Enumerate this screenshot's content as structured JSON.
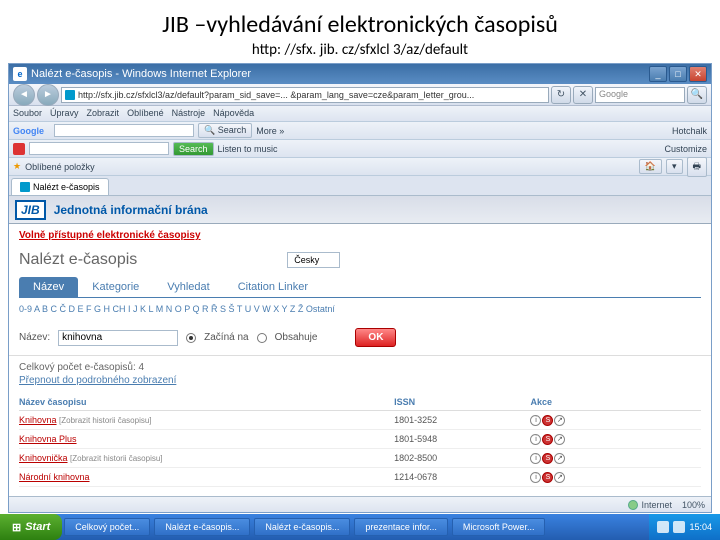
{
  "slide": {
    "title": "JIB –vyhledávání elektronických časopisů",
    "url": "http: //sfx. jib. cz/sfxlcl 3/az/default"
  },
  "window": {
    "title": "Nalézt e-časopis - Windows Internet Explorer",
    "url_display": "http://sfx.jib.cz/sfxlcl3/az/default?param_sid_save=... &param_lang_save=cze&param_letter_grou...",
    "search_placeholder": "Google"
  },
  "menubar": [
    "Soubor",
    "Úpravy",
    "Zobrazit",
    "Oblíbené",
    "Nástroje",
    "Nápověda"
  ],
  "google_toolbar": {
    "label": "Google",
    "search_btn": "Search",
    "more": "More »",
    "hotchalk": "Hotchalk"
  },
  "ask_toolbar": {
    "label": "",
    "search_btn": "Search",
    "listen": "Listen to music",
    "customize": "Customize"
  },
  "fav_toolbar": {
    "label": "Oblíbené položky"
  },
  "tab": "Nalézt e-časopis",
  "page": {
    "header_brand": "JIB",
    "header_text": "Jednotná informační brána",
    "redline": "Volně přístupné elektronické časopisy",
    "heading": "Nalézt e-časopis",
    "lang": "Česky",
    "tabs": [
      "Název",
      "Kategorie",
      "Vyhledat",
      "Citation Linker"
    ],
    "alpha": "0-9 A B C Č D E F G H CH I J K L M N O P Q R Ř S Š T U V W X Y Z Ž Ostatní",
    "name_label": "Název:",
    "name_value": "knihovna",
    "radio_begins": "Začíná na",
    "radio_contains": "Obsahuje",
    "ok": "OK",
    "total": "Celkový počet e-časopisů: 4",
    "switch": "Přepnout do podrobného zobrazení",
    "cols": {
      "name": "Název časopisu",
      "issn": "ISSN",
      "actions": "Akce"
    },
    "rows": [
      {
        "name": "Knihovna",
        "meta": "[Zobrazit historii časopisu]",
        "issn": "1801-3252"
      },
      {
        "name": "Knihovna Plus",
        "meta": "",
        "issn": "1801-5948"
      },
      {
        "name": "Knihovnička",
        "meta": "[Zobrazit historii časopisu]",
        "issn": "1802-8500"
      },
      {
        "name": "Národní knihovna",
        "meta": "",
        "issn": "1214-0678"
      }
    ]
  },
  "statusbar": {
    "zone": "Internet",
    "zoom": "100%"
  },
  "taskbar": {
    "start": "Start",
    "items": [
      "Celkový počet...",
      "Nalézt e-časopis...",
      "Nalézt e-časopis...",
      "prezentace infor...",
      "Microsoft Power..."
    ],
    "time": "15:04"
  }
}
